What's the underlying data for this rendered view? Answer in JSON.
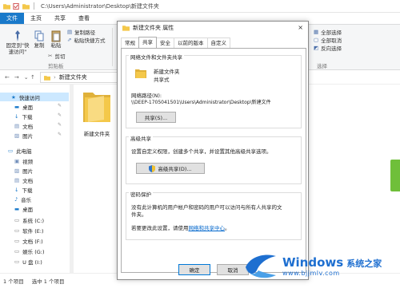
{
  "explorer": {
    "title_path": "C:\\Users\\Administrator\\Desktop\\新建文件夹",
    "tabs": [
      "文件",
      "主页",
      "共享",
      "查看"
    ],
    "ribbon": {
      "pin_label": "固定到\"快速访问\"",
      "copy_label": "复制",
      "paste_label": "粘贴",
      "copy_path_label": "复制路径",
      "paste_shortcut_label": "粘贴快捷方式",
      "cut_label": "剪切",
      "clipboard_group": "剪贴板",
      "select_all": "全部选择",
      "select_none": "全部取消",
      "invert_select": "反向选择",
      "select_group": "选择"
    },
    "address": "新建文件夹",
    "nav": {
      "quick_access": "快速访问",
      "items": [
        "桌面",
        "下载",
        "文档",
        "图片"
      ],
      "this_pc": "此电脑",
      "pc_items": [
        "视频",
        "图片",
        "文档",
        "下载",
        "音乐",
        "桌面",
        "系统 (C:)",
        "软件 (E:)",
        "文档 (F:)",
        "娱乐 (G:)",
        "U 盘 (I:)"
      ]
    },
    "folder_name": "新建文件夹",
    "status": {
      "count": "1 个项目",
      "selected": "选中 1 个项目"
    }
  },
  "dialog": {
    "title": "新建文件夹 属性",
    "close": "×",
    "tabs": [
      "常规",
      "共享",
      "安全",
      "以前的版本",
      "自定义"
    ],
    "active_tab": "共享",
    "share_section": {
      "title": "网络文件和文件夹共享",
      "folder_name": "新建文件夹",
      "folder_status": "共享式",
      "network_path_label": "网络路径(N):",
      "network_path": "\\\\DEEP-1705041501\\Users\\Administrator\\Desktop\\新建文件",
      "share_button": "共享(S)..."
    },
    "advanced_section": {
      "title": "高级共享",
      "desc": "设置自定义权限，创建多个共享，并设置其他高级共享选项。",
      "button": "高级共享(D)..."
    },
    "password_section": {
      "title": "密码保护",
      "desc1": "没有此计算机的用户帐户和密码的用户可以访问与所有人共享的文",
      "desc2": "件夹。",
      "change_prefix": "若要更改此设置，请使用",
      "change_link": "网络和共享中心",
      "change_suffix": "。"
    },
    "ok_button": "确定",
    "cancel_button": "取消"
  },
  "watermark": {
    "brand": "Windows",
    "site_cn": "系统之家",
    "url": "www.bjjmlv.com"
  },
  "colors": {
    "file_tab": "#1979ca",
    "selected_nav": "#cce8ff",
    "folder_yellow": "#f4c84a",
    "link": "#0066cc",
    "watermark_blue": "#1e6fd0"
  }
}
